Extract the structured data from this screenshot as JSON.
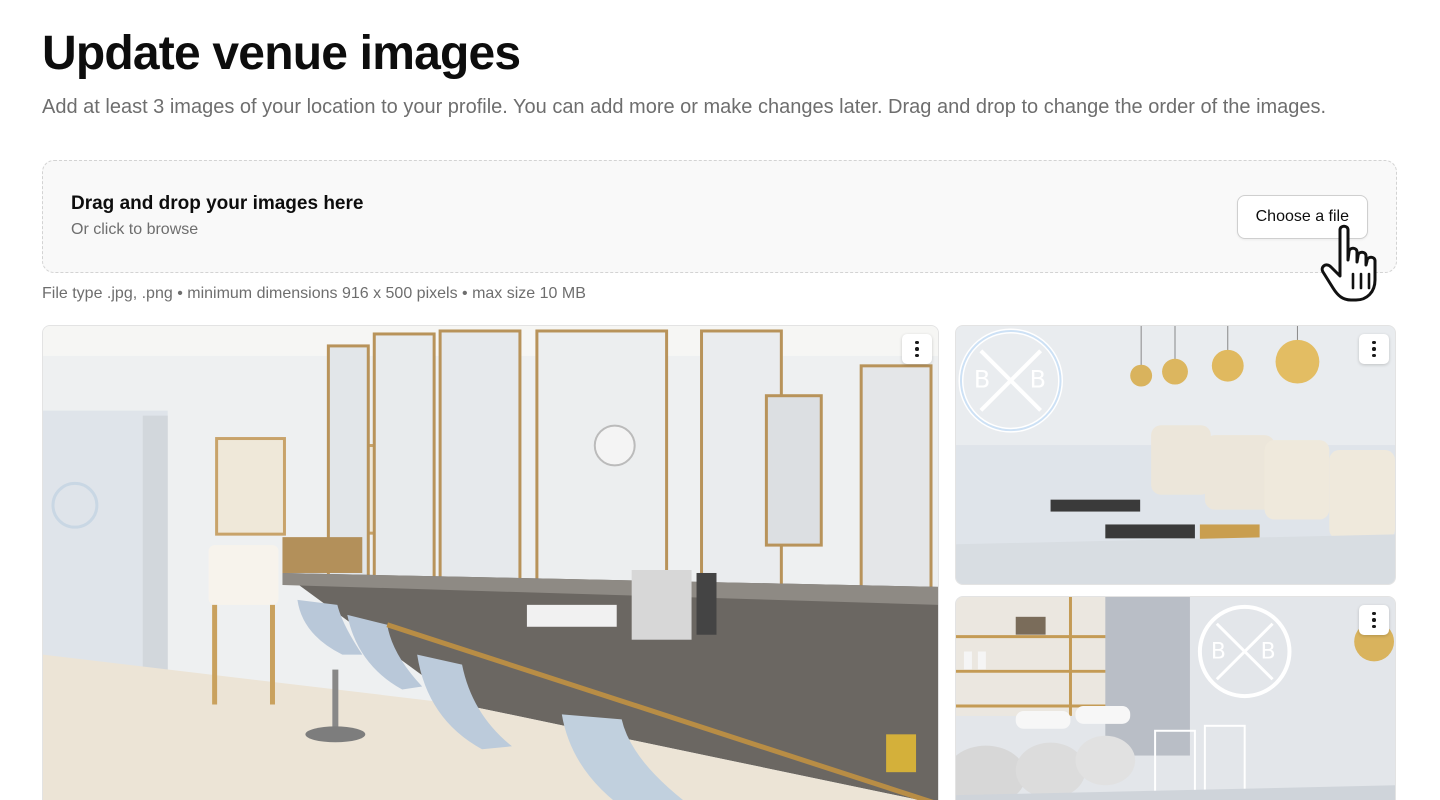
{
  "page": {
    "title": "Update venue images",
    "subtitle": "Add at least 3 images of your location to your profile. You can add more or make changes later. Drag and drop to change the order of the images."
  },
  "dropzone": {
    "title": "Drag and drop your images here",
    "subtitle": "Or click to browse",
    "button_label": "Choose a file"
  },
  "file_requirements": "File type .jpg, .png • minimum dimensions 916 x 500 pixels • max size 10 MB",
  "images": [
    {
      "menu_icon": "more-vertical-icon"
    },
    {
      "menu_icon": "more-vertical-icon"
    },
    {
      "menu_icon": "more-vertical-icon"
    }
  ],
  "colors": {
    "text_primary": "#0d0d0d",
    "text_secondary": "#6e6e6e",
    "dropzone_bg": "#f9f9f9",
    "dropzone_border": "#d3d3d3"
  }
}
